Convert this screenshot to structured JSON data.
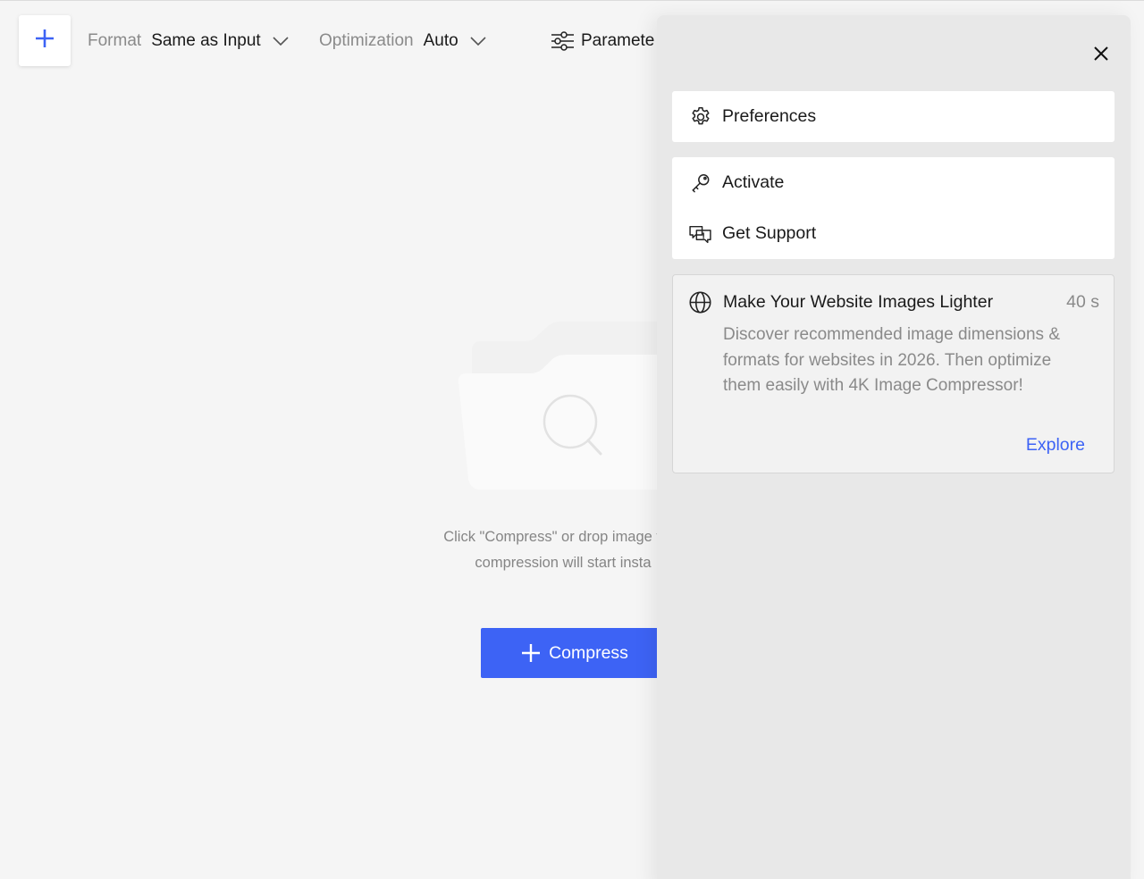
{
  "toolbar": {
    "add_icon": "plus-icon",
    "format_label": "Format",
    "format_value": "Same as Input",
    "optimization_label": "Optimization",
    "optimization_value": "Auto",
    "parameters_label": "Paramete",
    "parameters_icon": "sliders-icon"
  },
  "empty_state": {
    "illustration_icon": "folder-search-icon",
    "hint_line1": "Click \"Compress\" or drop image files",
    "hint_line2": "compression will start insta",
    "compress_label": "Compress"
  },
  "panel": {
    "close_icon": "close-icon",
    "preferences_label": "Preferences",
    "activate_label": "Activate",
    "support_label": "Get Support",
    "news": {
      "title": "Make Your Website Images Lighter",
      "time": "40 s",
      "body": "Discover recommended image dimensions & formats for websites in 2026. Then optimize them easily with 4K Image Compressor!",
      "link_label": "Explore"
    }
  },
  "colors": {
    "accent": "#3d63f5",
    "background": "#f5f5f5",
    "panel": "#e8e8e8"
  }
}
